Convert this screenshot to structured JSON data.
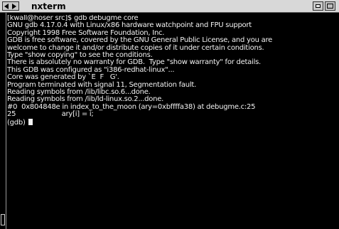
{
  "window": {
    "title": "nxterm"
  },
  "terminal": {
    "lines": [
      "[kwall@hoser src]$ gdb debugme core",
      "GNU gdb 4.17.0.4 with Linux/x86 hardware watchpoint and FPU support",
      "Copyright 1998 Free Software Foundation, Inc.",
      "GDB is free software, covered by the GNU General Public License, and you are",
      "welcome to change it and/or distribute copies of it under certain conditions.",
      "Type \"show copying\" to see the conditions.",
      "There is absolutely no warranty for GDB.  Type \"show warranty\" for details.",
      "This GDB was configured as \"i386-redhat-linux\"...",
      "Core was generated by `E  F   G'.",
      "Program terminated with signal 11, Segmentation fault.",
      "Reading symbols from /lib/libc.so.6...done.",
      "Reading symbols from /lib/ld-linux.so.2...done.",
      "#0  0x804848e in index_to_the_moon (ary=0xbffffa38) at debugme.c:25",
      "25                      ary[i] = i;"
    ],
    "prompt": "(gdb) "
  }
}
